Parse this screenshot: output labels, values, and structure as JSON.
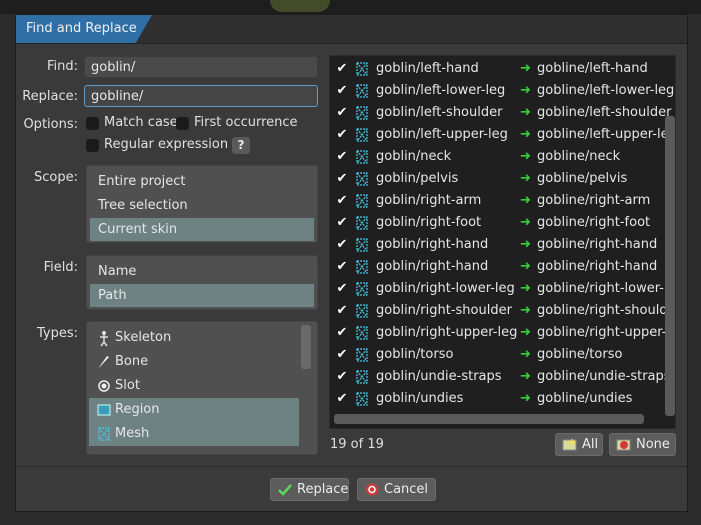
{
  "dialog": {
    "title": "Find and Replace"
  },
  "find": {
    "label": "Find:",
    "value": "goblin/"
  },
  "replace": {
    "label": "Replace:",
    "value": "gobline/"
  },
  "options": {
    "label": "Options:",
    "match_case": {
      "label": "Match case",
      "checked": false
    },
    "first_occurrence": {
      "label": "First occurrence",
      "checked": false
    },
    "regex": {
      "label": "Regular expression",
      "checked": false
    },
    "help": "?"
  },
  "scope": {
    "label": "Scope:",
    "items": [
      "Entire project",
      "Tree selection",
      "Current skin"
    ],
    "selected": "Current skin"
  },
  "field": {
    "label": "Field:",
    "items": [
      "Name",
      "Path"
    ],
    "selected": "Path"
  },
  "types": {
    "label": "Types:",
    "items": [
      {
        "label": "Skeleton",
        "icon": "skeleton-icon",
        "selected": false
      },
      {
        "label": "Bone",
        "icon": "bone-icon",
        "selected": false
      },
      {
        "label": "Slot",
        "icon": "slot-icon",
        "selected": false
      },
      {
        "label": "Region",
        "icon": "region-icon",
        "selected": true
      },
      {
        "label": "Mesh",
        "icon": "mesh-icon",
        "selected": true
      }
    ]
  },
  "results": {
    "rows": [
      {
        "from": "goblin/left-hand",
        "to": "gobline/left-hand"
      },
      {
        "from": "goblin/left-lower-leg",
        "to": "gobline/left-lower-leg"
      },
      {
        "from": "goblin/left-shoulder",
        "to": "gobline/left-shoulder"
      },
      {
        "from": "goblin/left-upper-leg",
        "to": "gobline/left-upper-leg"
      },
      {
        "from": "goblin/neck",
        "to": "gobline/neck"
      },
      {
        "from": "goblin/pelvis",
        "to": "gobline/pelvis"
      },
      {
        "from": "goblin/right-arm",
        "to": "gobline/right-arm"
      },
      {
        "from": "goblin/right-foot",
        "to": "gobline/right-foot"
      },
      {
        "from": "goblin/right-hand",
        "to": "gobline/right-hand"
      },
      {
        "from": "goblin/right-hand",
        "to": "gobline/right-hand"
      },
      {
        "from": "goblin/right-lower-leg",
        "to": "gobline/right-lower-leg"
      },
      {
        "from": "goblin/right-shoulder",
        "to": "gobline/right-shoulder"
      },
      {
        "from": "goblin/right-upper-leg",
        "to": "gobline/right-upper-leg"
      },
      {
        "from": "goblin/torso",
        "to": "gobline/torso"
      },
      {
        "from": "goblin/undie-straps",
        "to": "gobline/undie-straps"
      },
      {
        "from": "goblin/undies",
        "to": "gobline/undies"
      }
    ],
    "count_text": "19 of 19",
    "all_label": "All",
    "none_label": "None"
  },
  "footer": {
    "replace_label": "Replace",
    "cancel_label": "Cancel"
  },
  "colors": {
    "accent": "#2f6fa6",
    "selection": "#6e8283",
    "arrow": "#35d435"
  }
}
